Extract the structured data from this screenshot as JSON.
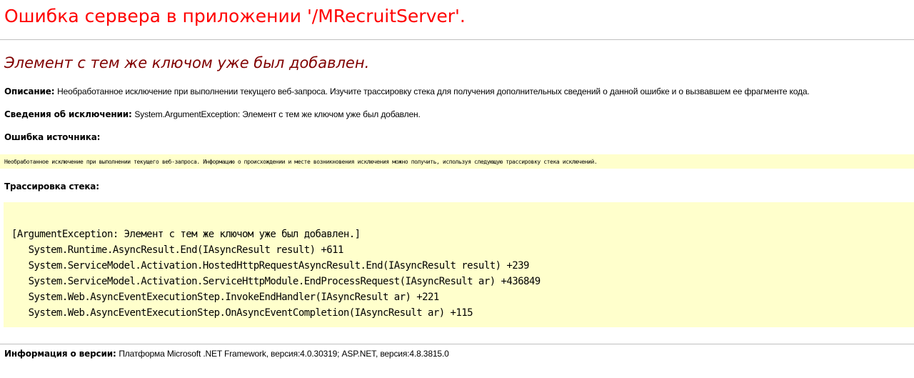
{
  "page": {
    "title": "Ошибка сервера в приложении '/MRecruitServer'.",
    "error_message": "Элемент с тем же ключом уже был добавлен."
  },
  "description": {
    "label": "Описание:",
    "text": "Необработанное исключение при выполнении текущего веб-запроса. Изучите трассировку стека для получения дополнительных сведений о данной ошибке и о вызвавшем ее фрагменте кода."
  },
  "exception_details": {
    "label": "Сведения об исключении:",
    "text": "System.ArgumentException: Элемент с тем же ключом уже был добавлен."
  },
  "source_error": {
    "label": "Ошибка источника:",
    "text": "Необработанное исключение при выполнении текущего веб-запроса. Информацию о происхождении и месте возникновения исключения можно получить, используя следующую трассировку стека исключений."
  },
  "stack_trace": {
    "label": "Трассировка стека:",
    "lines": [
      "[ArgumentException: Элемент с тем же ключом уже был добавлен.]",
      "   System.Runtime.AsyncResult.End(IAsyncResult result) +611",
      "   System.ServiceModel.Activation.HostedHttpRequestAsyncResult.End(IAsyncResult result) +239",
      "   System.ServiceModel.Activation.ServiceHttpModule.EndProcessRequest(IAsyncResult ar) +436849",
      "   System.Web.AsyncEventExecutionStep.InvokeEndHandler(IAsyncResult ar) +221",
      "   System.Web.AsyncEventExecutionStep.OnAsyncEventCompletion(IAsyncResult ar) +115"
    ]
  },
  "version_info": {
    "label": "Информация о версии:",
    "text": "Платформа Microsoft .NET Framework, версия:4.0.30319; ASP.NET, версия:4.8.3815.0"
  },
  "colors": {
    "title": "#ff0000",
    "error_heading": "#800000",
    "code_background": "#ffffcc",
    "divider": "#c0c0c0"
  }
}
